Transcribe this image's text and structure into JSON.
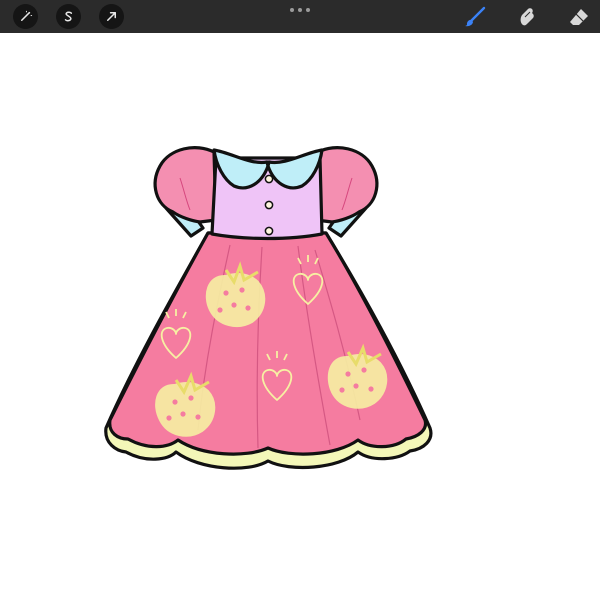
{
  "toolbar": {
    "left_tools": [
      {
        "icon": "magic-wand-icon",
        "name": "adjustments"
      },
      {
        "icon": "selection-s-icon",
        "name": "selection"
      },
      {
        "icon": "transform-arrow-icon",
        "name": "transform"
      }
    ],
    "center": {
      "icon": "more-dots-icon"
    },
    "right_tools": [
      {
        "icon": "brush-icon",
        "name": "brush",
        "active": true,
        "color": "#3b82f6"
      },
      {
        "icon": "smudge-icon",
        "name": "smudge",
        "active": false
      },
      {
        "icon": "eraser-icon",
        "name": "eraser",
        "active": false
      }
    ]
  },
  "canvas": {
    "background": "#ffffff",
    "artwork": "dress-illustration"
  },
  "colors": {
    "toolbar_bg": "#2b2b2b",
    "active_tool": "#3b82f6",
    "dress_pink": "#f57ca0",
    "sleeve_pink": "#f48fb1",
    "bodice_lilac": "#efc4f7",
    "collar_blue": "#bfeef8",
    "hem_yellow": "#f3f7b8",
    "motif_yellow": "#f7f0a3",
    "outline": "#111111"
  }
}
